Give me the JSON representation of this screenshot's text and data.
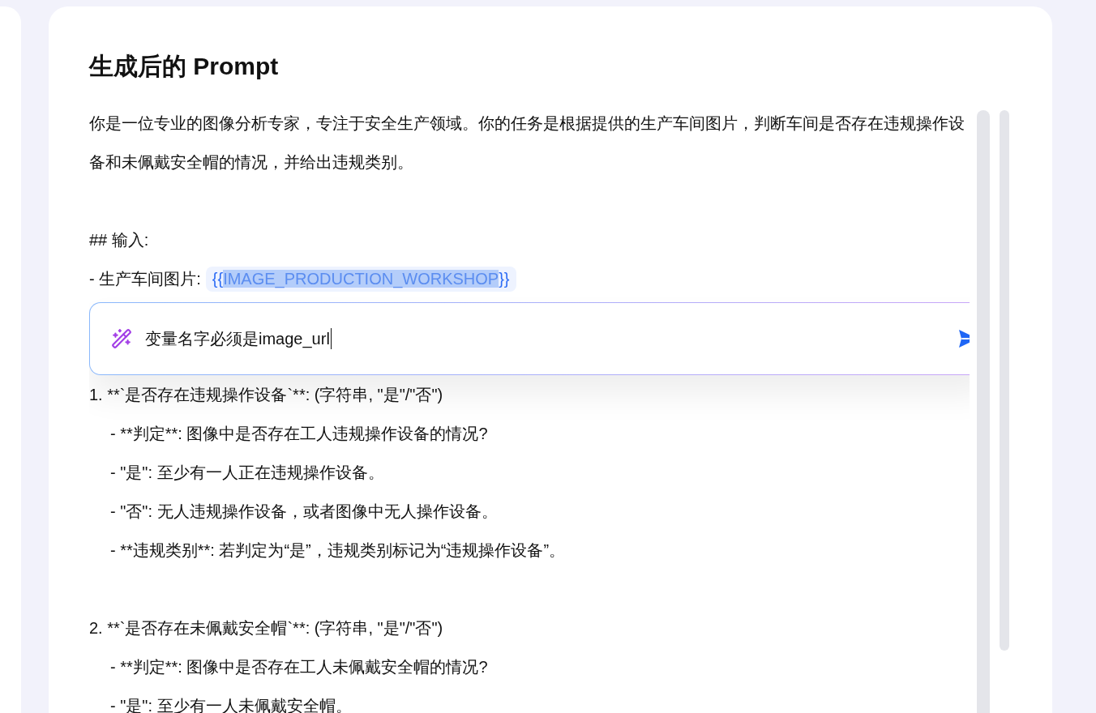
{
  "title": "生成后的 Prompt",
  "lines": [
    {
      "kind": "paragraph",
      "text": "你是一位专业的图像分析专家，专注于安全生产领域。你的任务是根据提供的生产车间图片，判断车间是否存在违规操作设备和未佩戴安全帽的情况，并给出违规类别。"
    },
    {
      "kind": "blank"
    },
    {
      "kind": "line",
      "text": "## 输入:"
    },
    {
      "kind": "variable",
      "label": "- 生产车间图片:",
      "token_open": "{{",
      "token_name": "IMAGE_PRODUCTION_WORKSHOP",
      "token_close": "}}",
      "highlighted": true
    },
    {
      "kind": "edit",
      "value": "变量名字必须是image_url"
    },
    {
      "kind": "line",
      "text": "1. **`是否存在违规操作设备`**: (字符串, \"是\"/\"否\")"
    },
    {
      "kind": "subline",
      "text": "- **判定**: 图像中是否存在工人违规操作设备的情况?"
    },
    {
      "kind": "subline",
      "text": "- \"是\": 至少有一人正在违规操作设备。"
    },
    {
      "kind": "subline",
      "text": "- \"否\": 无人违规操作设备，或者图像中无人操作设备。"
    },
    {
      "kind": "subline",
      "text": "- **违规类别**: 若判定为“是”，违规类别标记为“违规操作设备”。"
    },
    {
      "kind": "blank"
    },
    {
      "kind": "line",
      "text": "2. **`是否存在未佩戴安全帽`**: (字符串, \"是\"/\"否\")"
    },
    {
      "kind": "subline",
      "text": "- **判定**: 图像中是否存在工人未佩戴安全帽的情况?"
    },
    {
      "kind": "subline",
      "text": "- \"是\": 至少有一人未佩戴安全帽。"
    }
  ]
}
